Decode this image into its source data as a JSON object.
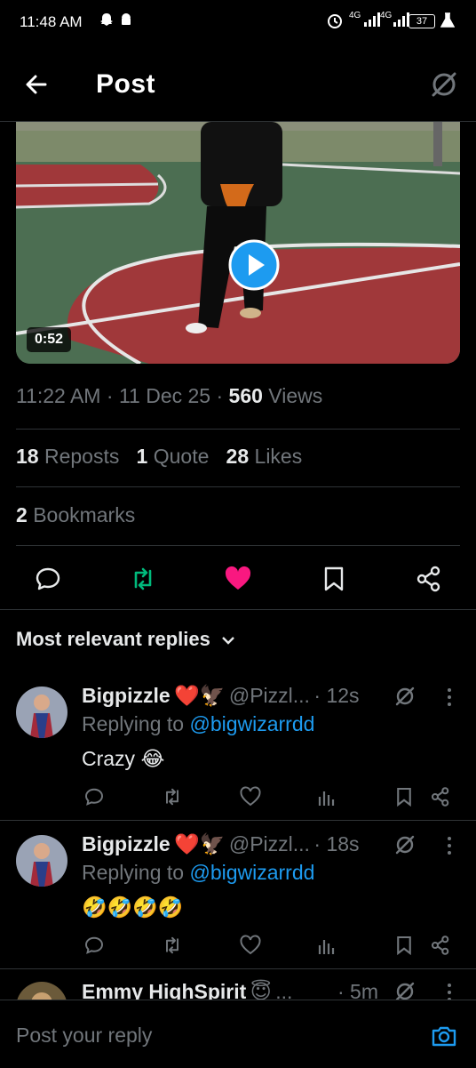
{
  "status_bar": {
    "time": "11:48 AM",
    "battery": "37",
    "network_a": "4G",
    "network_b": "4G"
  },
  "header": {
    "title": "Post"
  },
  "video": {
    "duration": "0:52"
  },
  "meta": {
    "time": "11:22 AM",
    "date": "11 Dec 25",
    "views_count": "560",
    "views_label": "Views",
    "sep": "·"
  },
  "stats": {
    "reposts_count": "18",
    "reposts_label": "Reposts",
    "quotes_count": "1",
    "quotes_label": "Quote",
    "likes_count": "28",
    "likes_label": "Likes",
    "bookmarks_count": "2",
    "bookmarks_label": "Bookmarks"
  },
  "colors": {
    "accent": "#1d9bf0",
    "repost": "#00ba7c",
    "like": "#f91880",
    "muted": "#71767b"
  },
  "replies_header": {
    "label": "Most relevant replies"
  },
  "replies": [
    {
      "name": "Bigpizzle",
      "emoji": "❤️🦅",
      "handle": "@Pizzl...",
      "time": "· 12s",
      "replying_prefix": "Replying to",
      "replying_to": "@bigwizarrdd",
      "text": "Crazy 😂"
    },
    {
      "name": "Bigpizzle",
      "emoji": "❤️🦅",
      "handle": "@Pizzl...",
      "time": "· 18s",
      "replying_prefix": "Replying to",
      "replying_to": "@bigwizarrdd",
      "text": "🤣🤣🤣🤣"
    },
    {
      "name": "Emmy HighSpirit",
      "emoji": "😇",
      "handle": "...",
      "time": "· 5m"
    }
  ],
  "reply_input": {
    "placeholder": "Post your reply"
  }
}
